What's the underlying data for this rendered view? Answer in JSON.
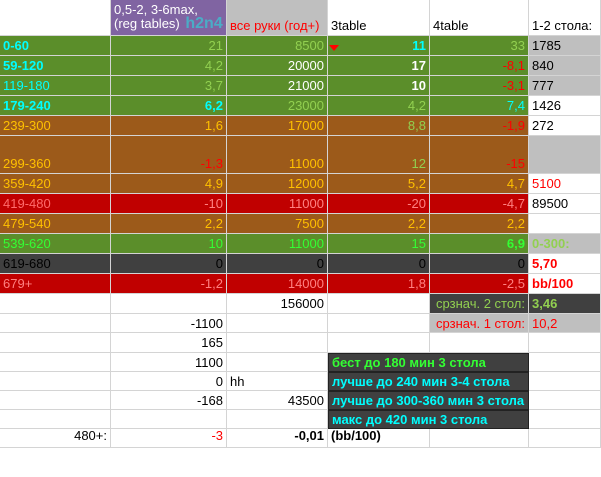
{
  "header": {
    "col_b_line1": "0,5-2, 3-6max,",
    "col_b_line2": "(reg tables)",
    "col_b_tag": "h2n4",
    "col_c": "все руки (год+)",
    "col_d": "3table",
    "col_e": "4table",
    "col_f": "1-2 стола:"
  },
  "rows": [
    {
      "range": "0-60",
      "b": "21",
      "c": "8500",
      "d": "11",
      "e": "33",
      "f": "1785"
    },
    {
      "range": "59-120",
      "b": "4,2",
      "c": "20000",
      "d": "17",
      "e": "-8,1",
      "f": "840"
    },
    {
      "range": "119-180",
      "b": "3,7",
      "c": "21000",
      "d": "10",
      "e": "-3,1",
      "f": "777"
    },
    {
      "range": "179-240",
      "b": "6,2",
      "c": "23000",
      "d": "4,2",
      "e": "7,4",
      "f": "1426"
    },
    {
      "range": "239-300",
      "b": "1,6",
      "c": "17000",
      "d": "8,8",
      "e": "-1,9",
      "f": "272"
    },
    {
      "range": "299-360",
      "b": "-1,3",
      "c": "11000",
      "d": "12",
      "e": "-15",
      "f": ""
    },
    {
      "range": "359-420",
      "b": "4,9",
      "c": "12000",
      "d": "5,2",
      "e": "4,7",
      "f": "5100"
    },
    {
      "range": "419-480",
      "b": "-10",
      "c": "11000",
      "d": "-20",
      "e": "-4,7",
      "f": "89500"
    },
    {
      "range": "479-540",
      "b": "2,2",
      "c": "7500",
      "d": "2,2",
      "e": "2,2",
      "f": ""
    },
    {
      "range": "539-620",
      "b": "10",
      "c": "11000",
      "d": "15",
      "e": "6,9",
      "f": "0-300:"
    },
    {
      "range": "619-680",
      "b": "0",
      "c": "0",
      "d": "0",
      "e": "0",
      "f": "5,70"
    },
    {
      "range": "679+",
      "b": "-1,2",
      "c": "14000",
      "d": "1,8",
      "e": "-2,5",
      "f": "bb/100"
    }
  ],
  "extra": {
    "total_hands": "156000",
    "avg2_label": "срзнач. 2 стол:",
    "avg2_value": "3,46",
    "avg1_label": "срзнач. 1 стол:",
    "avg1_value": "10,2",
    "v_minus1100": "-1100",
    "v_165": "165",
    "v_1100": "1100",
    "v_0": "0",
    "hh": "hh",
    "v_minus168": "-168",
    "v_43500": "43500",
    "footer_label": "480+:",
    "footer_b": "-3",
    "footer_c": "-0,01",
    "footer_d": "(bb/100)"
  },
  "legend": [
    "бест до 180 мин 3 стола",
    "лучше до 240 мин 3-4 стола",
    "лучше до 300-360 мин 3 стола",
    "макс до 420 мин 3 стола"
  ],
  "colors": {
    "green_row": "#5b8e2a",
    "orange_row": "#9c5a1a",
    "red_row": "#c00000",
    "dark_grey_row": "#404040",
    "header_purple": "#8064a2",
    "header_grey": "#bfbfbf"
  }
}
